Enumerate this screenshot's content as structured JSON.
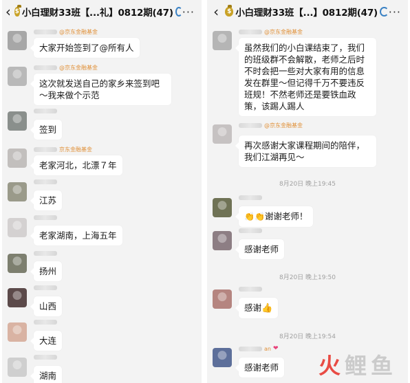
{
  "left": {
    "back_glyph": "‹",
    "bag_glyph": "$",
    "title": "小白理财33班【...礼】0812期(47)",
    "more_glyph": "···",
    "messages": [
      {
        "name": "@京东金融基金",
        "text": "大家开始签到了@所有人"
      },
      {
        "name": "@京东金融基金",
        "text": "这次就发送自己的家乡来签到吧～我来做个示范"
      },
      {
        "name": "",
        "text": "签到"
      },
      {
        "name": "京东金融基金",
        "text": "老家河北，北漂７年"
      },
      {
        "name": "",
        "text": "江苏"
      },
      {
        "name": "",
        "text": "老家湖南，上海五年"
      },
      {
        "name": "",
        "text": "扬州"
      },
      {
        "name": "",
        "text": "山西"
      },
      {
        "name": "",
        "text": "大连"
      },
      {
        "name": "",
        "text": "湖南"
      }
    ]
  },
  "right": {
    "back_glyph": "‹",
    "bag_glyph": "$",
    "title": "小白理财33班【...】0812期(47)",
    "more_glyph": "···",
    "messages": [
      {
        "name": "@京东金融基金",
        "text": "虽然我们的小白课结束了，我们的班级群不会解散，老师之后时不时会把一些对大家有用的信息发在群里～但记得千万不要违反班规！不然老师还是要铁血政策，该踢人踢人"
      },
      {
        "name": "@京东金融基金",
        "text": "再次感谢大家课程期间的陪伴，我们江湖再见～"
      },
      {
        "name": "",
        "text": "谢谢老师！"
      },
      {
        "name": "",
        "text": "感谢老师"
      },
      {
        "name": "",
        "text": "感谢"
      },
      {
        "name": "an",
        "text": "感谢老师"
      }
    ],
    "timestamps": [
      "8月20日 晚上19:45",
      "8月20日 晚上19:50",
      "8月20日 晚上19:54"
    ],
    "emoji": {
      "clap": "👏👏",
      "thumb": "👍",
      "heart": "❤"
    }
  },
  "watermark": [
    "火",
    "鲤",
    "鱼"
  ],
  "colors": {
    "chat_bg": "#f3f3f3",
    "bubble": "#ffffff",
    "name_orange": "#e0913a",
    "brand_red": "#e8433b"
  }
}
